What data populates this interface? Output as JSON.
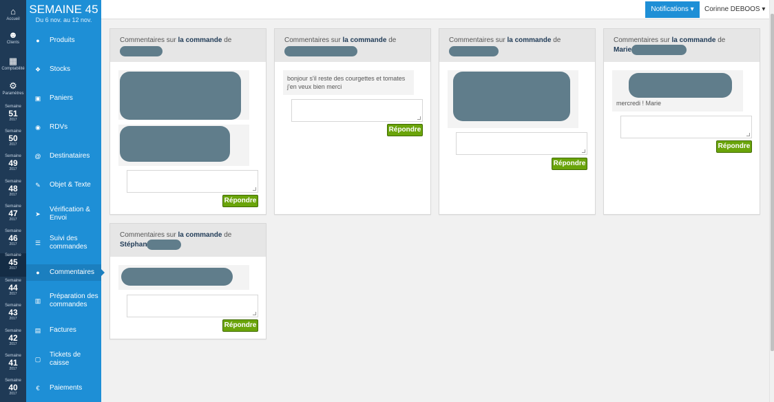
{
  "rail": {
    "items": [
      {
        "label": "Accueil",
        "icon": "home-icon",
        "glyph": "⌂"
      },
      {
        "label": "Clients",
        "icon": "users-icon",
        "glyph": "☻"
      },
      {
        "label": "Comptabilité",
        "icon": "calculator-icon",
        "glyph": "▦"
      },
      {
        "label": "Paramètres",
        "icon": "gear-icon",
        "glyph": "⚙"
      }
    ],
    "week_label": "Semaine",
    "weeks": [
      {
        "num": "51",
        "year": "2017"
      },
      {
        "num": "50",
        "year": "2017"
      },
      {
        "num": "49",
        "year": "2017"
      },
      {
        "num": "48",
        "year": "2017"
      },
      {
        "num": "47",
        "year": "2017"
      },
      {
        "num": "46",
        "year": "2017"
      },
      {
        "num": "45",
        "year": "2017"
      },
      {
        "num": "44",
        "year": "2017"
      },
      {
        "num": "43",
        "year": "2017"
      },
      {
        "num": "42",
        "year": "2017"
      },
      {
        "num": "41",
        "year": "2017"
      },
      {
        "num": "40",
        "year": "2017"
      }
    ]
  },
  "sidebar": {
    "title": "SEMAINE 45",
    "subtitle": "Du 6 nov. au 12 nov.",
    "items": [
      {
        "label": "Produits",
        "icon": "apple-icon",
        "glyph": "●"
      },
      {
        "label": "Stocks",
        "icon": "cubes-icon",
        "glyph": "❖"
      },
      {
        "label": "Paniers",
        "icon": "basket-icon",
        "glyph": "▣"
      },
      {
        "label": "RDVs",
        "icon": "map-marker-icon",
        "glyph": "◉"
      },
      {
        "label": "Destinataires",
        "icon": "at-icon",
        "glyph": "@"
      },
      {
        "label": "Objet & Texte",
        "icon": "pencil-icon",
        "glyph": "✎"
      },
      {
        "label": "Vérification & Envoi",
        "icon": "send-icon",
        "glyph": "➤"
      },
      {
        "label": "Suivi des commandes",
        "icon": "list-icon",
        "glyph": "☰"
      },
      {
        "label": "Commentaires",
        "icon": "comment-icon",
        "glyph": "●"
      },
      {
        "label": "Préparation des commandes",
        "icon": "map-icon",
        "glyph": "▥"
      },
      {
        "label": "Factures",
        "icon": "file-icon",
        "glyph": "▤"
      },
      {
        "label": "Tickets de caisse",
        "icon": "receipt-icon",
        "glyph": "▢"
      },
      {
        "label": "Paiements",
        "icon": "euro-icon",
        "glyph": "€"
      }
    ]
  },
  "topbar": {
    "notifications": "Notifications ▾",
    "user": "Corinne DEBOOS ▾"
  },
  "cards": [
    {
      "head_prefix": "Commentaires sur",
      "head_link": "la commande",
      "head_suffix": "de",
      "name": "",
      "comments": [],
      "reply": "Répondre"
    },
    {
      "head_prefix": "Commentaires sur",
      "head_link": "la commande",
      "head_suffix": "de",
      "name": "",
      "comments": [
        "bonjour s'il reste des courgettes et tomates j'en veux bien merci"
      ],
      "reply": "Répondre"
    },
    {
      "head_prefix": "Commentaires sur",
      "head_link": "la commande",
      "head_suffix": "de",
      "name": "",
      "comments": [],
      "reply": "Répondre"
    },
    {
      "head_prefix": "Commentaires sur",
      "head_link": "la commande",
      "head_suffix": "de",
      "name": "Marie",
      "comments": [
        "mercredi ! Marie"
      ],
      "reply": "Répondre"
    },
    {
      "head_prefix": "Commentaires sur",
      "head_link": "la commande",
      "head_suffix": "de",
      "name": "Stéphan",
      "comments": [],
      "reply": "Répondre"
    }
  ]
}
